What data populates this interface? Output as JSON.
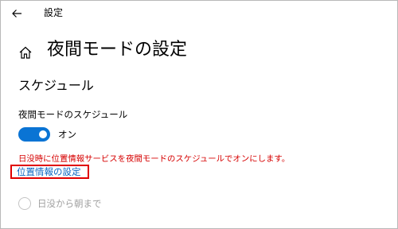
{
  "titlebar": {
    "title": "設定"
  },
  "page": {
    "title": "夜間モードの設定"
  },
  "schedule": {
    "section_title": "スケジュール",
    "label": "夜間モードのスケジュール",
    "toggle_state": "オン",
    "toggle_on": true
  },
  "notice": {
    "message": "日没時に位置情報サービスを夜間モードのスケジュールでオンにします。",
    "link_label": "位置情報の設定"
  },
  "options": {
    "sunset_to_sunrise_label": "日没から朝まで"
  },
  "colors": {
    "accent": "#0a74d4",
    "warning": "#d60000",
    "link": "#0a66c2",
    "highlight_border": "#e00000",
    "disabled_text": "#a0a0a0"
  },
  "icons": {
    "back": "arrow-left-icon",
    "home": "home-icon"
  }
}
